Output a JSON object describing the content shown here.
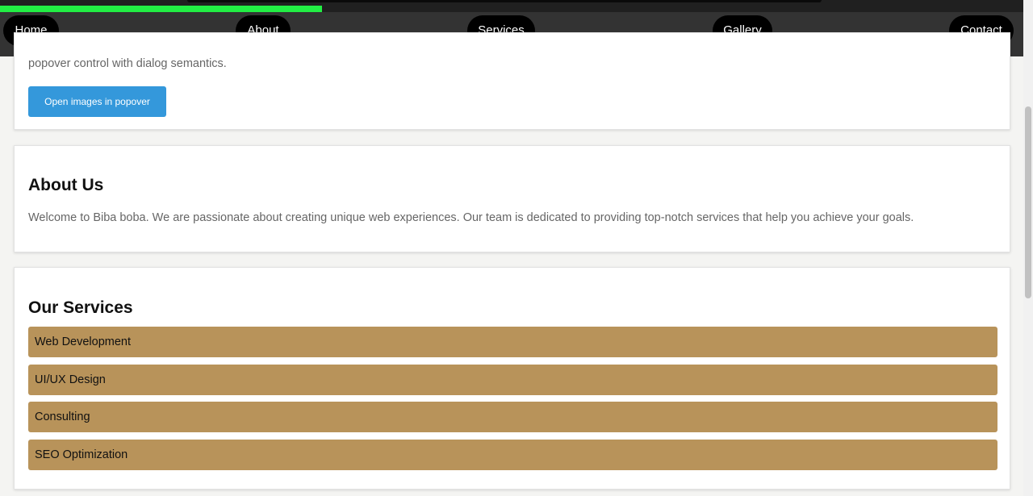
{
  "progress": {
    "fraction": 0.315,
    "color": "#22ee44"
  },
  "nav": {
    "items": [
      {
        "label": "Home"
      },
      {
        "label": "About"
      },
      {
        "label": "Services"
      },
      {
        "label": "Gallery"
      },
      {
        "label": "Contact"
      }
    ]
  },
  "popover_section": {
    "text": "popover control with dialog semantics.",
    "button_label": "Open images in popover"
  },
  "about": {
    "title": "About Us",
    "text": "Welcome to Biba boba. We are passionate about creating unique web experiences. Our team is dedicated to providing top-notch services that help you achieve your goals."
  },
  "services": {
    "title": "Our Services",
    "items": [
      {
        "label": "Web Development"
      },
      {
        "label": "UI/UX Design"
      },
      {
        "label": "Consulting"
      },
      {
        "label": "SEO Optimization"
      }
    ]
  },
  "colors": {
    "nav_bg": "#333333",
    "button_blue": "#3498db",
    "service_bg": "#b8935a"
  }
}
